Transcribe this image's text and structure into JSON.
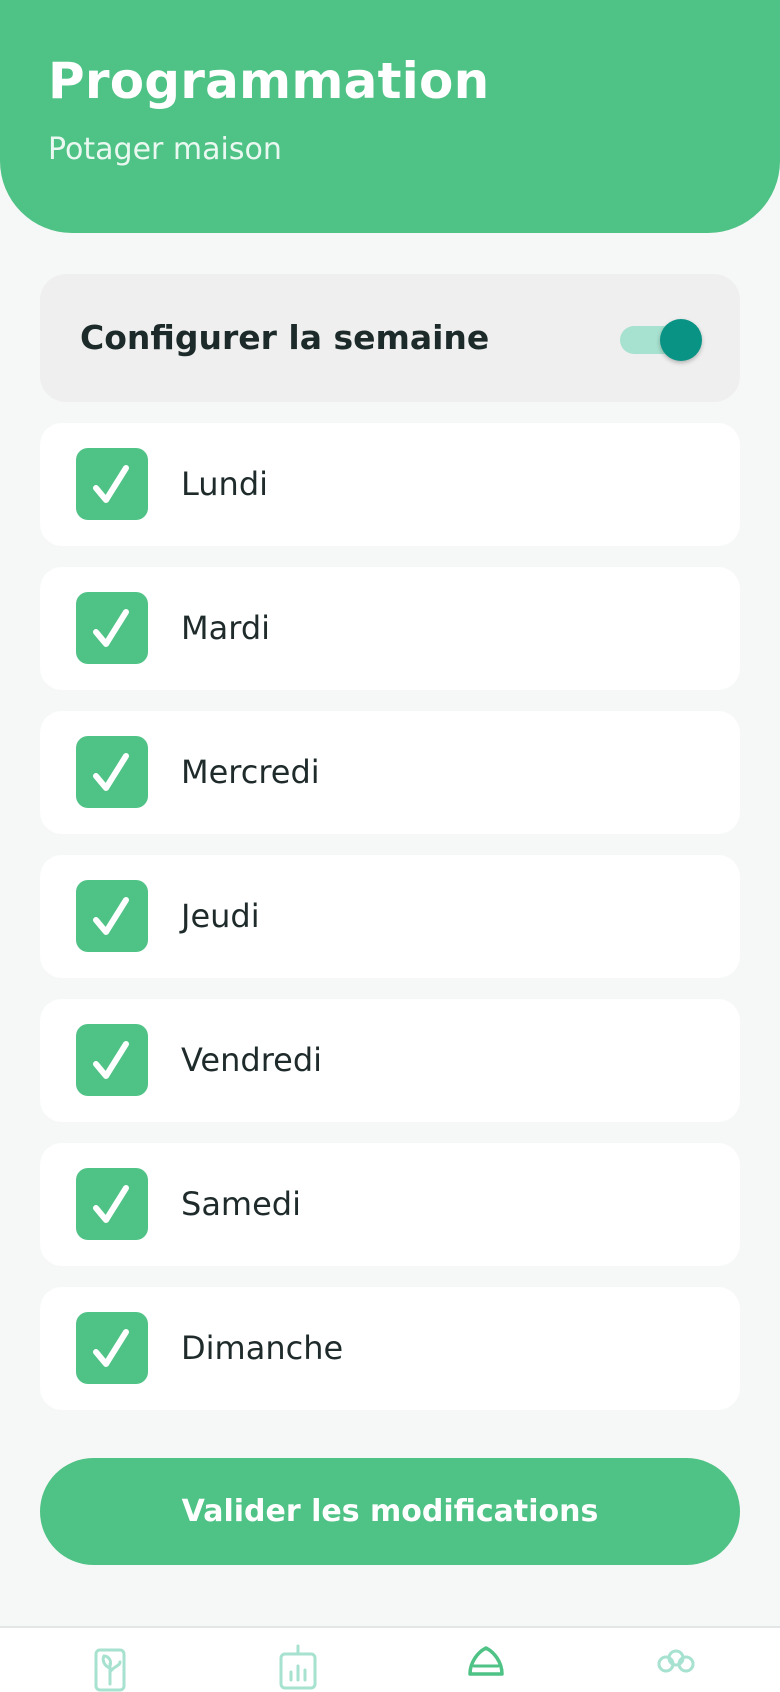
{
  "header": {
    "title": "Programmation",
    "subtitle": "Potager maison"
  },
  "week_config": {
    "label": "Configurer la semaine",
    "enabled": true
  },
  "days": [
    {
      "label": "Lundi",
      "checked": true
    },
    {
      "label": "Mardi",
      "checked": true
    },
    {
      "label": "Mercredi",
      "checked": true
    },
    {
      "label": "Jeudi",
      "checked": true
    },
    {
      "label": "Vendredi",
      "checked": true
    },
    {
      "label": "Samedi",
      "checked": true
    },
    {
      "label": "Dimanche",
      "checked": true
    }
  ],
  "submit": {
    "label": "Valider les modifications"
  },
  "bottom_nav": {
    "items": [
      {
        "icon": "plant-icon",
        "active": false
      },
      {
        "icon": "chart-icon",
        "active": false
      },
      {
        "icon": "watering-icon",
        "active": true
      },
      {
        "icon": "community-icon",
        "active": false
      }
    ]
  },
  "colors": {
    "accent": "#4fc285",
    "toggle_knob": "#089385",
    "toggle_track": "#a7e1cf",
    "background": "#f6f7f7"
  }
}
